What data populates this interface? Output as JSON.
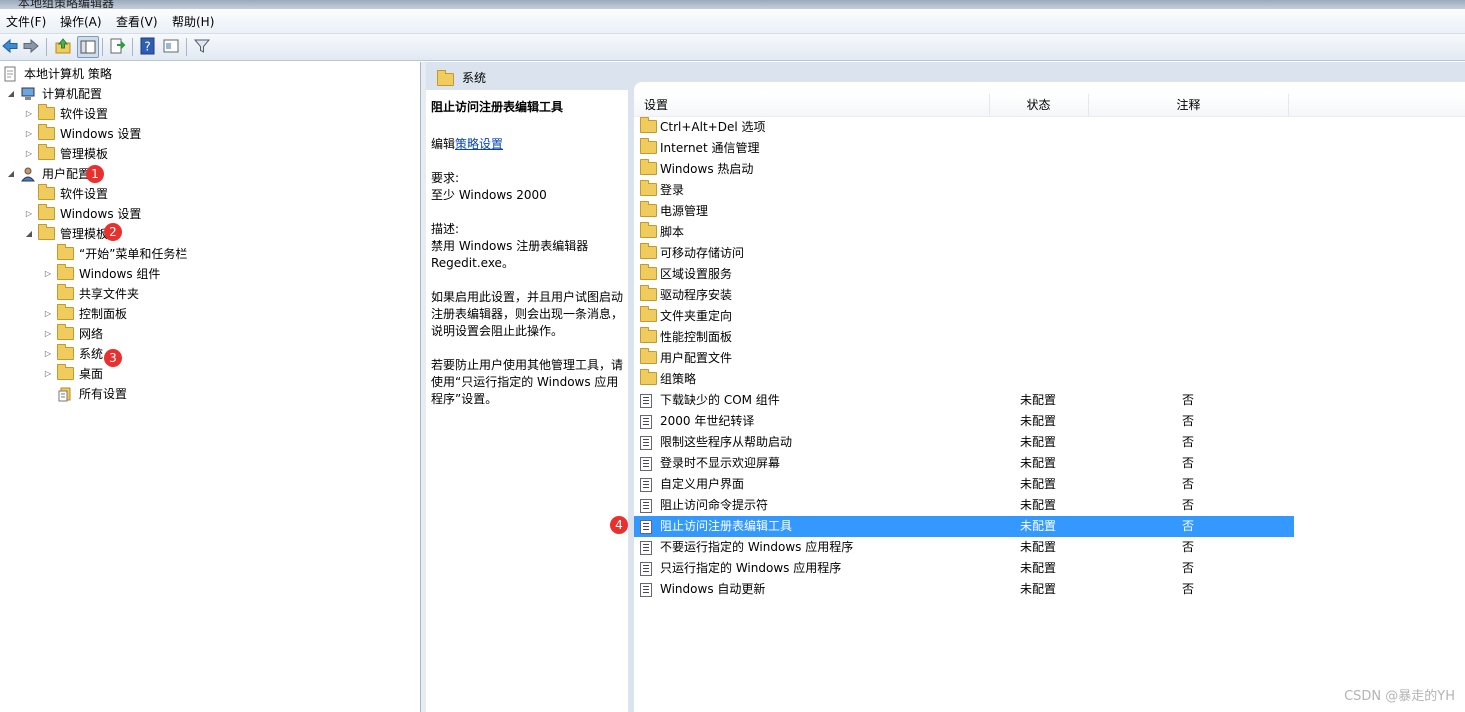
{
  "window": {
    "title": "本地组策略编辑器"
  },
  "menu": [
    "文件(F)",
    "操作(A)",
    "查看(V)",
    "帮助(H)"
  ],
  "toolbar": [
    "back-icon",
    "forward-icon",
    "up-folder-icon",
    "show-hide-tree-icon",
    "export-list-icon",
    "help-icon",
    "properties-icon",
    "filter-icon"
  ],
  "tree": [
    {
      "label": "本地计算机 策略",
      "level": 0,
      "expand": "",
      "icon": "policy"
    },
    {
      "label": "计算机配置",
      "level": 1,
      "expand": "open",
      "icon": "computer"
    },
    {
      "label": "软件设置",
      "level": 2,
      "expand": "closed",
      "icon": "folder"
    },
    {
      "label": "Windows 设置",
      "level": 2,
      "expand": "closed",
      "icon": "folder"
    },
    {
      "label": "管理模板",
      "level": 2,
      "expand": "closed",
      "icon": "folder"
    },
    {
      "label": "用户配置",
      "level": 1,
      "expand": "open",
      "icon": "user"
    },
    {
      "label": "软件设置",
      "level": 2,
      "expand": "",
      "icon": "folder"
    },
    {
      "label": "Windows 设置",
      "level": 2,
      "expand": "closed",
      "icon": "folder"
    },
    {
      "label": "管理模板",
      "level": 2,
      "expand": "open",
      "icon": "folder"
    },
    {
      "label": "“开始”菜单和任务栏",
      "level": 3,
      "expand": "",
      "icon": "folder"
    },
    {
      "label": "Windows 组件",
      "level": 3,
      "expand": "closed",
      "icon": "folder"
    },
    {
      "label": "共享文件夹",
      "level": 3,
      "expand": "",
      "icon": "folder"
    },
    {
      "label": "控制面板",
      "level": 3,
      "expand": "closed",
      "icon": "folder"
    },
    {
      "label": "网络",
      "level": 3,
      "expand": "closed",
      "icon": "folder"
    },
    {
      "label": "系统",
      "level": 3,
      "expand": "closed",
      "icon": "folder"
    },
    {
      "label": "桌面",
      "level": 3,
      "expand": "closed",
      "icon": "folder"
    },
    {
      "label": "所有设置",
      "level": 3,
      "expand": "",
      "icon": "allsettings"
    }
  ],
  "badges": [
    "1",
    "2",
    "3",
    "4"
  ],
  "right_header": "系统",
  "description": {
    "title": "阻止访问注册表编辑工具",
    "edit_prefix": "编辑",
    "edit_link": "策略设置",
    "req_label": "要求:",
    "req_value": "至少 Windows 2000",
    "desc_label": "描述:",
    "lines": [
      "禁用 Windows 注册表编辑器",
      "Regedit.exe。",
      "如果启用此设置，并且用户试图启动",
      "注册表编辑器，则会出现一条消息，",
      "说明设置会阻止此操作。",
      "若要防止用户使用其他管理工具，请",
      "使用“只运行指定的 Windows 应用",
      "程序”设置。"
    ]
  },
  "columns": [
    "设置",
    "状态",
    "注释"
  ],
  "rows": [
    {
      "name": "Ctrl+Alt+Del 选项",
      "type": "folder",
      "state": "",
      "note": ""
    },
    {
      "name": "Internet 通信管理",
      "type": "folder",
      "state": "",
      "note": ""
    },
    {
      "name": "Windows 热启动",
      "type": "folder",
      "state": "",
      "note": ""
    },
    {
      "name": "登录",
      "type": "folder",
      "state": "",
      "note": ""
    },
    {
      "name": "电源管理",
      "type": "folder",
      "state": "",
      "note": ""
    },
    {
      "name": "脚本",
      "type": "folder",
      "state": "",
      "note": ""
    },
    {
      "name": "可移动存储访问",
      "type": "folder",
      "state": "",
      "note": ""
    },
    {
      "name": "区域设置服务",
      "type": "folder",
      "state": "",
      "note": ""
    },
    {
      "name": "驱动程序安装",
      "type": "folder",
      "state": "",
      "note": ""
    },
    {
      "name": "文件夹重定向",
      "type": "folder",
      "state": "",
      "note": ""
    },
    {
      "name": "性能控制面板",
      "type": "folder",
      "state": "",
      "note": ""
    },
    {
      "name": "用户配置文件",
      "type": "folder",
      "state": "",
      "note": ""
    },
    {
      "name": "组策略",
      "type": "folder",
      "state": "",
      "note": ""
    },
    {
      "name": "下载缺少的 COM 组件",
      "type": "policy",
      "state": "未配置",
      "note": "否"
    },
    {
      "name": "2000 年世纪转译",
      "type": "policy",
      "state": "未配置",
      "note": "否"
    },
    {
      "name": "限制这些程序从帮助启动",
      "type": "policy",
      "state": "未配置",
      "note": "否"
    },
    {
      "name": "登录时不显示欢迎屏幕",
      "type": "policy",
      "state": "未配置",
      "note": "否"
    },
    {
      "name": "自定义用户界面",
      "type": "policy",
      "state": "未配置",
      "note": "否"
    },
    {
      "name": "阻止访问命令提示符",
      "type": "policy",
      "state": "未配置",
      "note": "否"
    },
    {
      "name": "阻止访问注册表编辑工具",
      "type": "policy",
      "state": "未配置",
      "note": "否",
      "selected": true
    },
    {
      "name": "不要运行指定的 Windows 应用程序",
      "type": "policy",
      "state": "未配置",
      "note": "否"
    },
    {
      "name": "只运行指定的 Windows 应用程序",
      "type": "policy",
      "state": "未配置",
      "note": "否"
    },
    {
      "name": "Windows 自动更新",
      "type": "policy",
      "state": "未配置",
      "note": "否"
    }
  ],
  "watermark": "CSDN @暴走的YH",
  "colors": {
    "selection": "#3399ff",
    "badge": "#e8302e",
    "link": "#0645ad"
  }
}
